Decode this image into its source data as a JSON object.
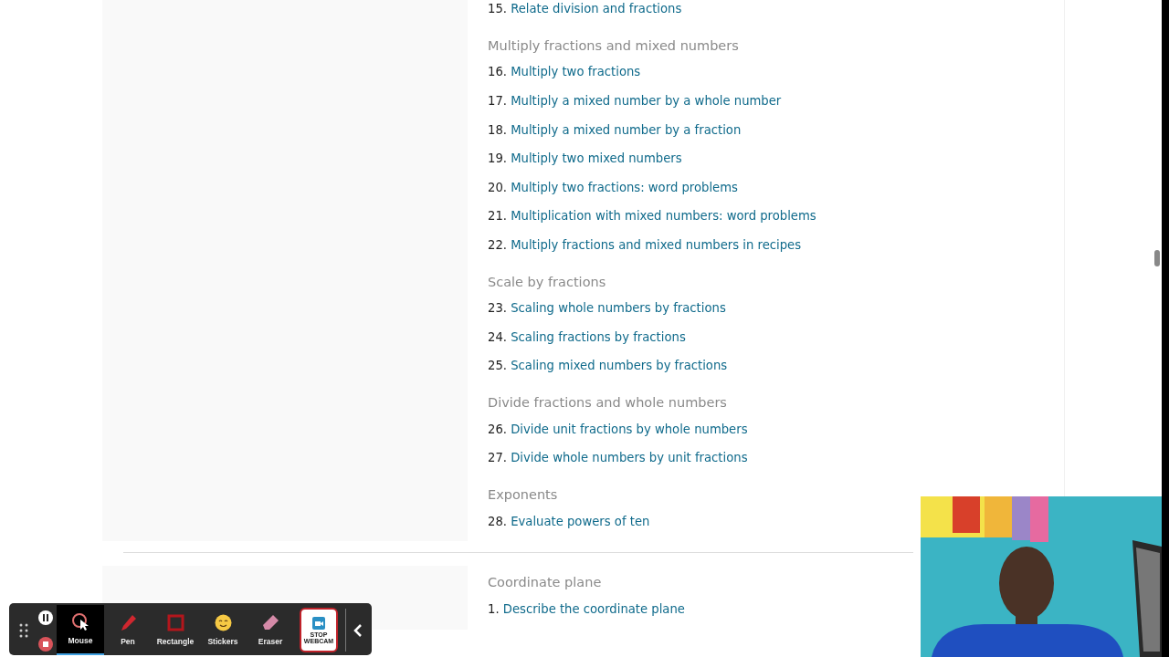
{
  "groups": [
    {
      "sections": [
        {
          "skills": [
            {
              "number": "15.",
              "label": "Relate division and fractions"
            }
          ]
        },
        {
          "heading": "Multiply fractions and mixed numbers",
          "skills": [
            {
              "number": "16.",
              "label": "Multiply two fractions"
            },
            {
              "number": "17.",
              "label": "Multiply a mixed number by a whole number"
            },
            {
              "number": "18.",
              "label": "Multiply a mixed number by a fraction"
            },
            {
              "number": "19.",
              "label": "Multiply two mixed numbers"
            },
            {
              "number": "20.",
              "label": "Multiply two fractions: word problems"
            },
            {
              "number": "21.",
              "label": "Multiplication with mixed numbers: word problems"
            },
            {
              "number": "22.",
              "label": "Multiply fractions and mixed numbers in recipes"
            }
          ]
        },
        {
          "heading": "Scale by fractions",
          "skills": [
            {
              "number": "23.",
              "label": "Scaling whole numbers by fractions"
            },
            {
              "number": "24.",
              "label": "Scaling fractions by fractions"
            },
            {
              "number": "25.",
              "label": "Scaling mixed numbers by fractions"
            }
          ]
        },
        {
          "heading": "Divide fractions and whole numbers",
          "skills": [
            {
              "number": "26.",
              "label": "Divide unit fractions by whole numbers"
            },
            {
              "number": "27.",
              "label": "Divide whole numbers by unit fractions"
            }
          ]
        },
        {
          "heading": "Exponents",
          "skills": [
            {
              "number": "28.",
              "label": "Evaluate powers of ten"
            }
          ]
        }
      ]
    },
    {
      "sections": [
        {
          "heading": "Coordinate plane",
          "skills": [
            {
              "number": "1.",
              "label": "Describe the coordinate plane"
            }
          ]
        }
      ]
    }
  ],
  "toolbar": {
    "tools": [
      {
        "kind": "mouse",
        "label": "Mouse",
        "selected": true
      },
      {
        "kind": "pen",
        "label": "Pen",
        "selected": false
      },
      {
        "kind": "rectangle",
        "label": "Rectangle",
        "selected": false
      },
      {
        "kind": "stickers",
        "label": "Stickers",
        "selected": false
      },
      {
        "kind": "eraser",
        "label": "Eraser",
        "selected": false
      }
    ],
    "webcam_button": "STOP WEBCAM"
  }
}
